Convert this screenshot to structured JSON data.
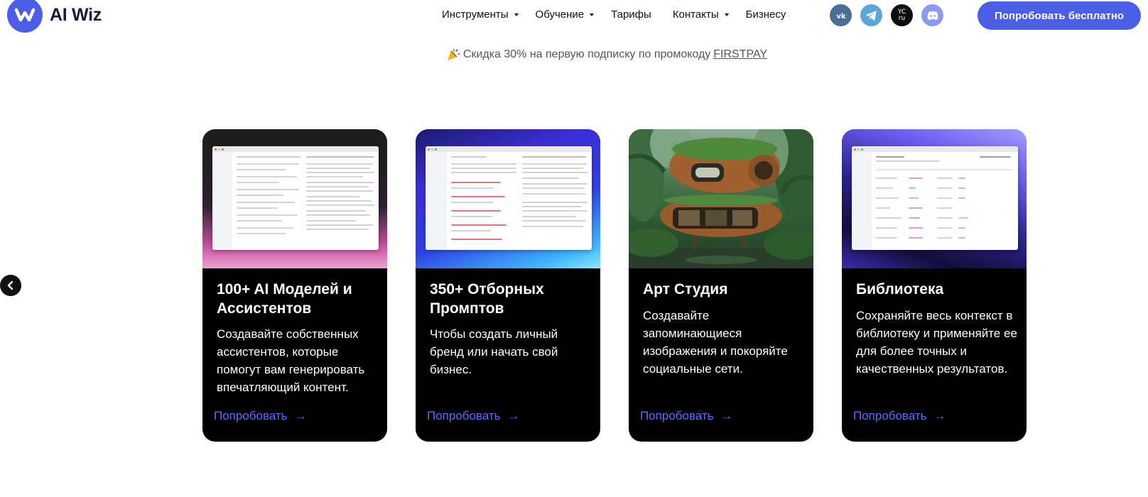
{
  "brand": {
    "name": "AI Wiz"
  },
  "nav": {
    "items": [
      {
        "label": "Инструменты",
        "dropdown": true
      },
      {
        "label": "Обучение",
        "dropdown": true
      },
      {
        "label": "Тарифы",
        "dropdown": false
      },
      {
        "label": "Контакты",
        "dropdown": true
      },
      {
        "label": "Бизнесу",
        "dropdown": false
      }
    ]
  },
  "socials": [
    {
      "name": "vk-icon",
      "label": "VK"
    },
    {
      "name": "telegram-icon",
      "label": "Telegram"
    },
    {
      "name": "vc-ru-icon",
      "label": "VC RU"
    },
    {
      "name": "discord-icon",
      "label": "Discord"
    }
  ],
  "cta": {
    "label": "Попробовать бесплатно"
  },
  "promo": {
    "text": "Скидка 30% на первую подписку по промокоду",
    "code": "FIRSTPAY",
    "icon": "party-popper-icon"
  },
  "cards": [
    {
      "title": "100+ AI Моделей и Ассистентов",
      "description": "Создавайте собственных ассистентов, которые помогут вам генерировать впечатляющий контент.",
      "link": "Попробовать",
      "arrow": "→"
    },
    {
      "title": "350+ Отборных Промптов",
      "description": "Чтобы создать личный бренд или начать свой бизнес.",
      "link": "Попробовать",
      "arrow": "→"
    },
    {
      "title": "Арт Студия",
      "description": "Создавайте запоминающиеся изображения и покоряйте социальные сети.",
      "link": "Попробовать",
      "arrow": "→"
    },
    {
      "title": "Библиотека",
      "description": "Сохраняйте весь контекст в библиотеку и применяйте ее для более точных и качественных результатов.",
      "link": "Попробовать",
      "arrow": "→"
    }
  ],
  "colors": {
    "accent": "#4a5ee6",
    "link": "#5b6cff",
    "card_bg": "#000000"
  }
}
